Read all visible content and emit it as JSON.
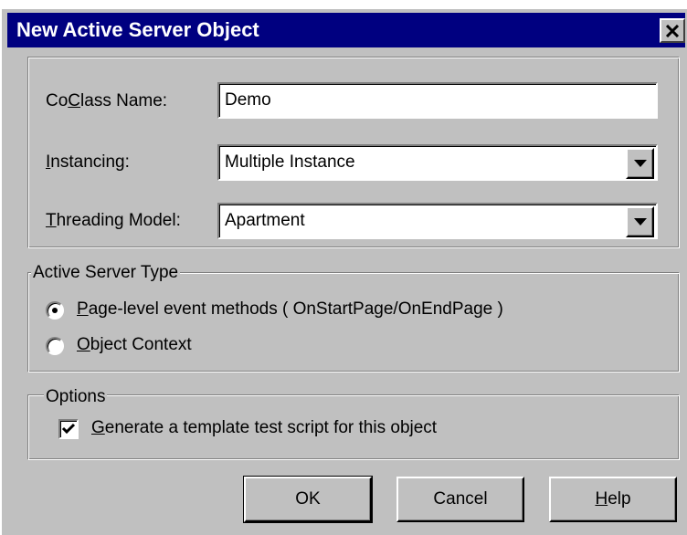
{
  "window": {
    "title": "New Active Server Object",
    "close_symbol": "✕"
  },
  "fields": {
    "coclass_label_pre": "Co",
    "coclass_label_key": "C",
    "coclass_label_post": "lass Name:",
    "coclass_value": "Demo",
    "instancing_label_key": "I",
    "instancing_label_post": "nstancing:",
    "instancing_value": "Multiple Instance",
    "threading_label_key": "T",
    "threading_label_post": "hreading Model:",
    "threading_value": "Apartment"
  },
  "server_type": {
    "legend": "Active Server Type",
    "option1_key": "P",
    "option1_rest": "age-level event methods ( OnStartPage/OnEndPage )",
    "option1_selected": true,
    "option2_key": "O",
    "option2_rest": "bject Context",
    "option2_selected": false
  },
  "options": {
    "legend": "Options",
    "checkbox_key": "G",
    "checkbox_rest": "enerate a template test script for this object",
    "checkbox_checked": true
  },
  "buttons": {
    "ok": "OK",
    "cancel": "Cancel",
    "help_key": "H",
    "help_rest": "elp"
  },
  "colors": {
    "titlebar": "#000080",
    "face": "#c0c0c0"
  },
  "icons": {
    "close": "close-icon",
    "dropdown": "chevron-down-icon",
    "check": "checkmark-icon"
  }
}
